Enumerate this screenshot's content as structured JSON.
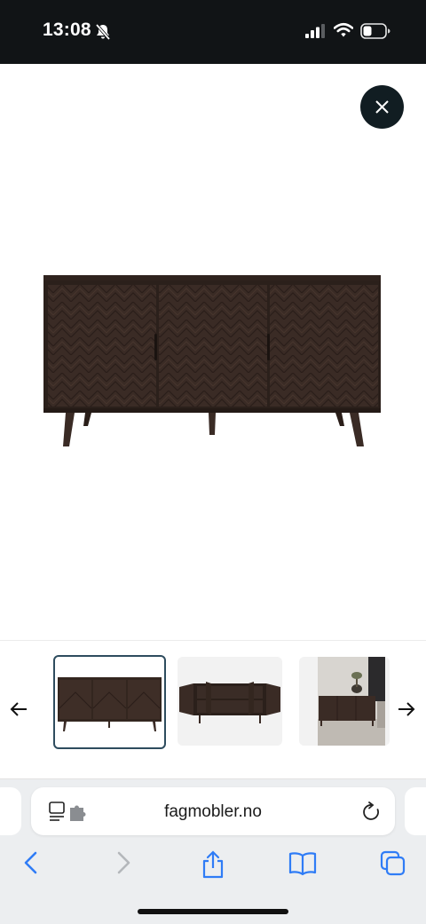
{
  "status_bar": {
    "time": "13:08",
    "icons": [
      "bell-slash-icon",
      "signal-icon",
      "wifi-icon",
      "battery-icon"
    ]
  },
  "product_viewer": {
    "close_icon": "close-icon",
    "main_image": "sideboard-front",
    "thumbnails": [
      {
        "image": "sideboard-front",
        "selected": true
      },
      {
        "image": "sideboard-open-doors",
        "selected": false
      },
      {
        "image": "sideboard-room-scene",
        "selected": false
      }
    ],
    "prev_icon": "arrow-left-icon",
    "next_icon": "arrow-right-icon"
  },
  "browser": {
    "url": "fagmobler.no",
    "icons": [
      "reader-extension-icon",
      "reload-icon",
      "back-icon",
      "forward-icon",
      "share-icon",
      "bookmarks-icon",
      "tabs-icon"
    ]
  },
  "colors": {
    "status_bg": "#111416",
    "close_bg": "#111d22",
    "selected_border": "#2e4c5e",
    "toolbar_blue": "#2f7cf6",
    "wood": "#3a2b25"
  }
}
